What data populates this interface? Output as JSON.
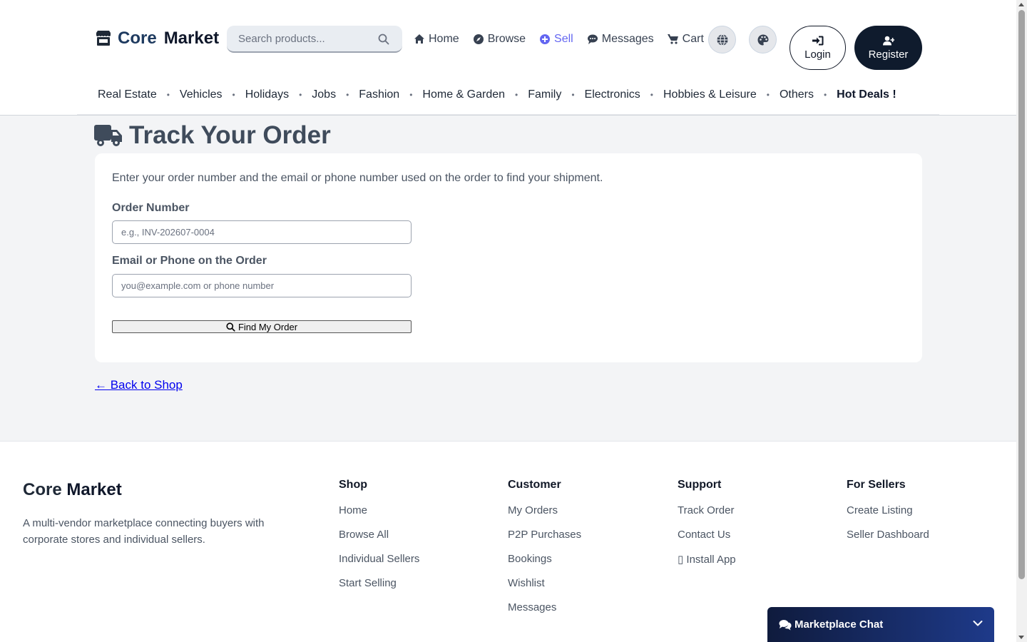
{
  "brand": {
    "core": "Core",
    "market": "Market"
  },
  "search": {
    "placeholder": "Search products..."
  },
  "topnav": {
    "home": "Home",
    "browse": "Browse",
    "sell": "Sell",
    "messages": "Messages",
    "cart": "Cart"
  },
  "auth": {
    "login": "Login",
    "register": "Register"
  },
  "categories": [
    "Real Estate",
    "Vehicles",
    "Holidays",
    "Jobs",
    "Fashion",
    "Home & Garden",
    "Family",
    "Electronics",
    "Hobbies & Leisure",
    "Others",
    "Hot Deals !"
  ],
  "category_separator": "•",
  "main": {
    "title": "Track Your Order",
    "intro": "Enter your order number and the email or phone number used on the order to find your shipment.",
    "order_label": "Order Number",
    "order_placeholder": "e.g., INV-202607-0004",
    "contact_label": "Email or Phone on the Order",
    "contact_placeholder": "you@example.com or phone number",
    "find_button": "Find My Order",
    "back_link": "← Back to Shop"
  },
  "footer": {
    "brand_1": "Core",
    "brand_2": "Market",
    "description": "A multi-vendor marketplace connecting buyers with corporate stores and individual sellers.",
    "columns": [
      {
        "heading": "Shop",
        "links": [
          "Home",
          "Browse All",
          "Individual Sellers",
          "Start Selling"
        ]
      },
      {
        "heading": "Customer",
        "links": [
          "My Orders",
          "P2P Purchases",
          "Bookings",
          "Wishlist",
          "Messages"
        ]
      },
      {
        "heading": "Support",
        "links": [
          "Track Order",
          "Contact Us",
          "▯ Install App"
        ]
      },
      {
        "heading": "For Sellers",
        "links": [
          "Create Listing",
          "Seller Dashboard"
        ]
      }
    ]
  },
  "chat": {
    "label": "Marketplace Chat"
  },
  "colors": {
    "accent": "#6366f1",
    "dark": "#0f1b2d",
    "link": "#0000ee"
  }
}
